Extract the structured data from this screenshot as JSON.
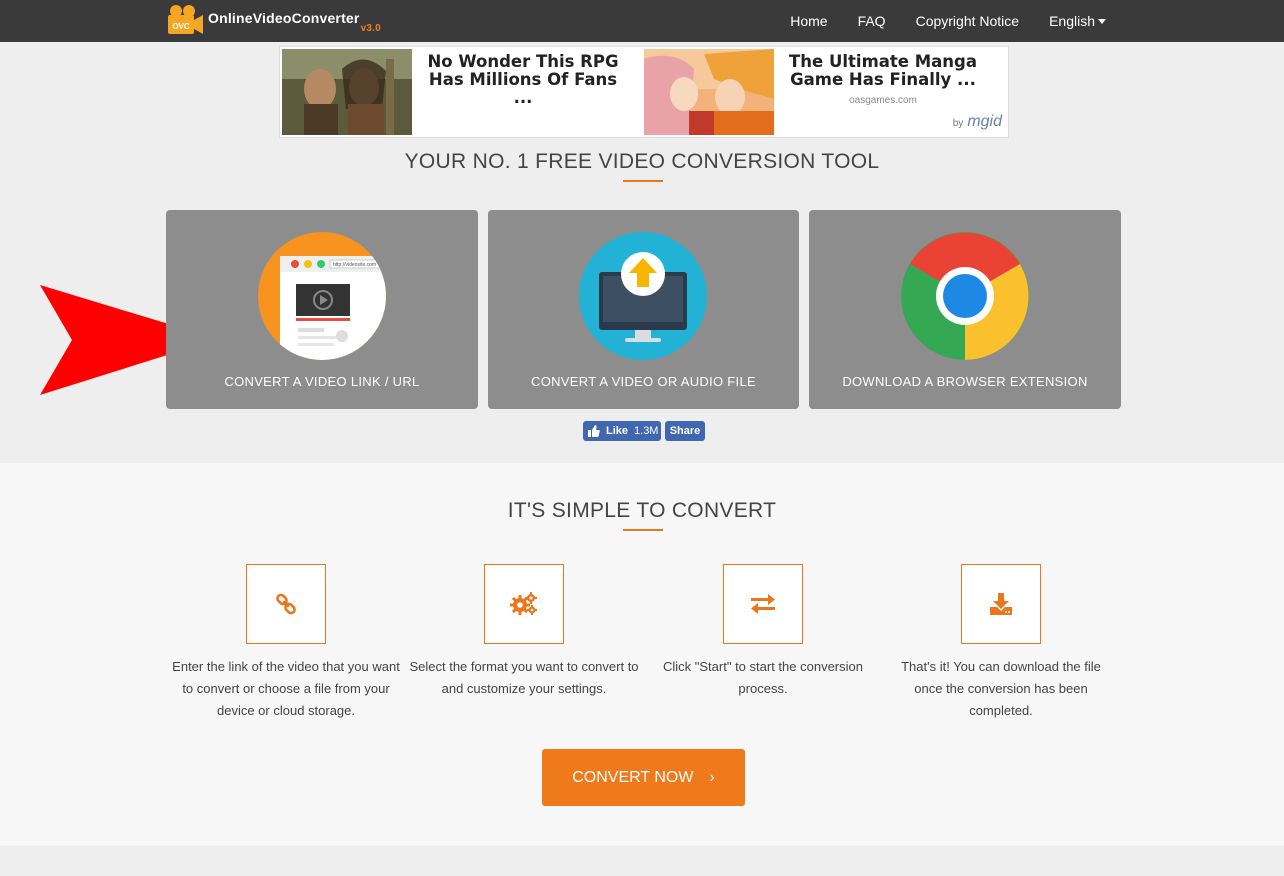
{
  "header": {
    "logo": {
      "badge": "OVC",
      "part1": "Online",
      "part2": "Video",
      "part3": "Converter",
      "version": "v3.0"
    },
    "nav": [
      {
        "label": "Home"
      },
      {
        "label": "FAQ"
      },
      {
        "label": "Copyright Notice"
      },
      {
        "label": "English"
      }
    ]
  },
  "ad": {
    "item1_title": "No Wonder This RPG Has Millions Of Fans ...",
    "item2_title": "The Ultimate Manga Game Has Finally ...",
    "item2_source": "oasgames.com",
    "by": "by",
    "brand": "mgid"
  },
  "hero": {
    "title": "YOUR NO. 1 FREE VIDEO CONVERSION TOOL"
  },
  "cards": [
    {
      "label": "CONVERT A VIDEO LINK / URL",
      "icon": "browser-video-icon",
      "url_text": "http://videosite.com"
    },
    {
      "label": "CONVERT A VIDEO OR AUDIO FILE",
      "icon": "upload-monitor-icon"
    },
    {
      "label": "DOWNLOAD A BROWSER EXTENSION",
      "icon": "chrome-icon"
    }
  ],
  "facebook": {
    "like": "Like",
    "count": "1.3M",
    "share": "Share"
  },
  "simple": {
    "title": "IT'S SIMPLE TO CONVERT",
    "steps": [
      {
        "icon": "link-icon",
        "text": "Enter the link of the video that you want to convert or choose a file from your device or cloud storage."
      },
      {
        "icon": "gears-icon",
        "text": "Select the format you want to convert to and customize your settings."
      },
      {
        "icon": "exchange-icon",
        "text": "Click \"Start\" to start the conversion process."
      },
      {
        "icon": "download-icon",
        "text": "That's it! You can download the file once the conversion has been completed."
      }
    ]
  },
  "cta": {
    "label": "CONVERT NOW",
    "chevron": "›"
  },
  "colors": {
    "accent": "#ef7a1c",
    "nav_bg": "#3a3a3a",
    "card_bg": "#8d8d8d",
    "facebook": "#4267b2",
    "arrow": "#ff0000"
  }
}
